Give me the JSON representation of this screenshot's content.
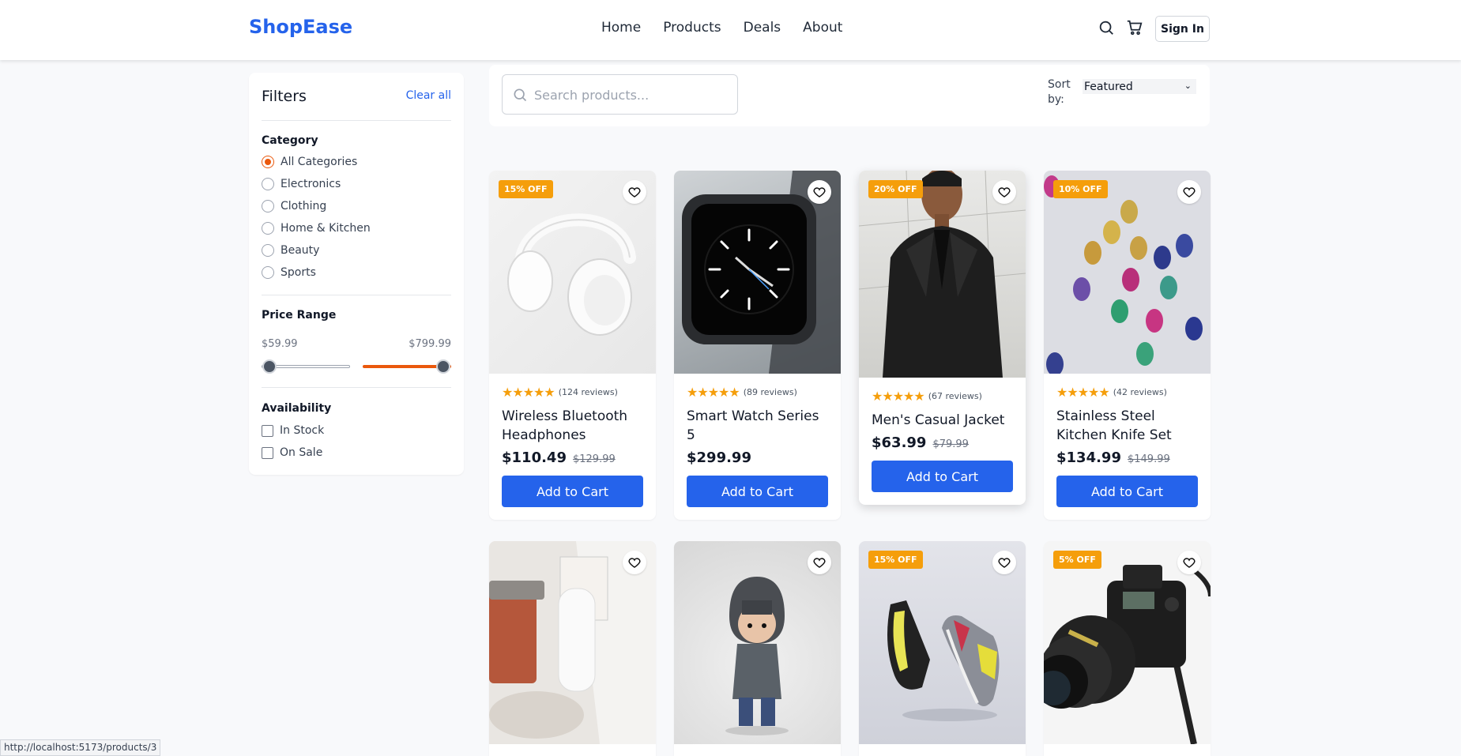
{
  "header": {
    "brand": "ShopEase",
    "nav": [
      "Home",
      "Products",
      "Deals",
      "About"
    ],
    "sign_in": "Sign In"
  },
  "filters": {
    "title": "Filters",
    "clear_all": "Clear all",
    "category_title": "Category",
    "categories": [
      "All Categories",
      "Electronics",
      "Clothing",
      "Home & Kitchen",
      "Beauty",
      "Sports"
    ],
    "selected_category": "All Categories",
    "price_title": "Price Range",
    "price_min": "$59.99",
    "price_max": "$799.99",
    "availability_title": "Availability",
    "availability": [
      "In Stock",
      "On Sale"
    ]
  },
  "toolbar": {
    "search_placeholder": "Search products...",
    "sort_label": "Sort by:",
    "sort_value": "Featured"
  },
  "products": [
    {
      "badge": "15% OFF",
      "reviews": "(124 reviews)",
      "name": "Wireless Bluetooth Headphones",
      "price": "$110.49",
      "old": "$129.99",
      "cta": "Add to Cart"
    },
    {
      "badge": "",
      "reviews": "(89 reviews)",
      "name": "Smart Watch Series 5",
      "price": "$299.99",
      "old": "",
      "cta": "Add to Cart"
    },
    {
      "badge": "20% OFF",
      "reviews": "(67 reviews)",
      "name": "Men's Casual Jacket",
      "price": "$63.99",
      "old": "$79.99",
      "cta": "Add to Cart"
    },
    {
      "badge": "10% OFF",
      "reviews": "(42 reviews)",
      "name": "Stainless Steel Kitchen Knife Set",
      "price": "$134.99",
      "old": "$149.99",
      "cta": "Add to Cart"
    },
    {
      "badge": ""
    },
    {
      "badge": ""
    },
    {
      "badge": "15% OFF"
    },
    {
      "badge": "5% OFF"
    }
  ],
  "status_url": "http://localhost:5173/products/3",
  "colors": {
    "accent": "#2563eb",
    "badge": "#f59e0b",
    "range": "#ea580c",
    "star": "#f59e0b"
  }
}
